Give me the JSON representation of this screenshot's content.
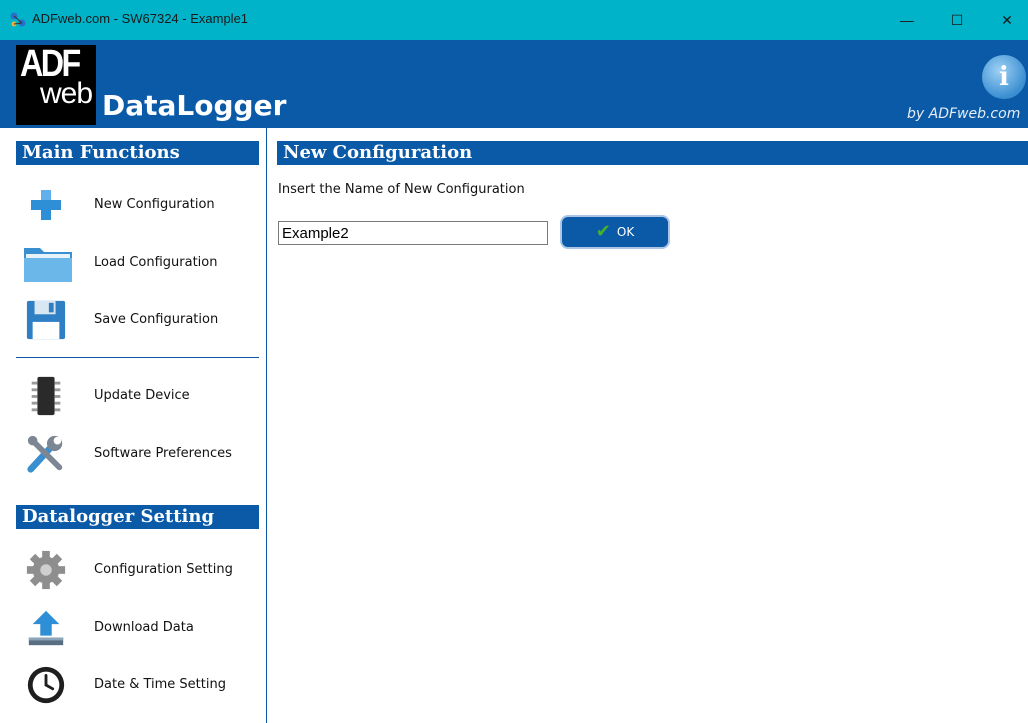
{
  "window": {
    "title": "ADFweb.com - SW67324 - Example1",
    "minimize_glyph": "—",
    "maximize_glyph": "☐",
    "close_glyph": "✕"
  },
  "header": {
    "logo_line1": "ADF",
    "logo_line2": "web",
    "product": "DataLogger",
    "byline": "by ADFweb.com",
    "info_glyph": "i"
  },
  "sidebar": {
    "main_functions_title": "Main Functions",
    "main_items": [
      {
        "label": "New Configuration",
        "icon": "plus-icon"
      },
      {
        "label": "Load Configuration",
        "icon": "folder-icon"
      },
      {
        "label": "Save Configuration",
        "icon": "floppy-icon"
      }
    ],
    "tools_items": [
      {
        "label": "Update Device",
        "icon": "chip-icon"
      },
      {
        "label": "Software Preferences",
        "icon": "tools-icon"
      }
    ],
    "datalogger_title": "Datalogger Setting",
    "datalogger_items": [
      {
        "label": "Configuration Setting",
        "icon": "gear-icon"
      },
      {
        "label": "Download Data",
        "icon": "download-icon"
      },
      {
        "label": "Date & Time Setting",
        "icon": "clock-icon"
      }
    ]
  },
  "main": {
    "title": "New Configuration",
    "prompt": "Insert the Name of New Configuration",
    "name_value": "Example2",
    "ok_label": "OK",
    "ok_glyph": "✔"
  },
  "colors": {
    "titlebar": "#00b3c9",
    "brand_blue": "#0a5aa8",
    "check_green": "#47b12b"
  }
}
